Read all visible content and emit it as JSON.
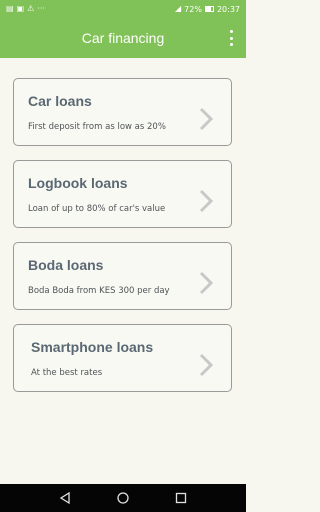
{
  "status_bar": {
    "battery": "72%",
    "time": "20:37"
  },
  "app_bar": {
    "title": "Car financing",
    "menu_icon": "more-vert-icon"
  },
  "cards": [
    {
      "title": "Car loans",
      "subtitle": "First deposit from as low as 20%"
    },
    {
      "title": "Logbook loans",
      "subtitle": "Loan of up to 80% of car's value"
    },
    {
      "title": "Boda loans",
      "subtitle": "Boda Boda from KES 300 per day"
    },
    {
      "title": "Smartphone loans",
      "subtitle": "At the best rates"
    }
  ],
  "nav_bar": {
    "back_icon": "back-triangle-icon",
    "home_icon": "home-circle-icon",
    "recents_icon": "recents-square-icon"
  },
  "colors": {
    "primary": "#80c257",
    "background": "#f7f7f0",
    "card_title": "#5a6873",
    "card_border": "#9a9a9a"
  }
}
